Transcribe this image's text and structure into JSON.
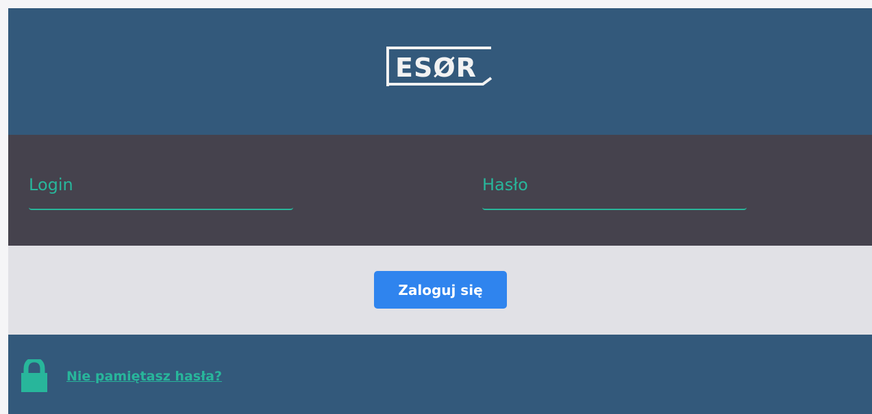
{
  "logo": {
    "text": "ESØR"
  },
  "login_form": {
    "login_placeholder": "Login",
    "password_placeholder": "Hasło",
    "login_value": "",
    "password_value": ""
  },
  "actions": {
    "login_button": "Zaloguj się"
  },
  "footer": {
    "lock_icon": "lock-icon",
    "forgot_password": "Nie pamiętasz hasła?"
  },
  "colors": {
    "header": "#33597b",
    "fields_background": "#45424d",
    "actions_background": "#e1e1e6",
    "accent": "#28b69b",
    "button": "#2f84ee"
  }
}
